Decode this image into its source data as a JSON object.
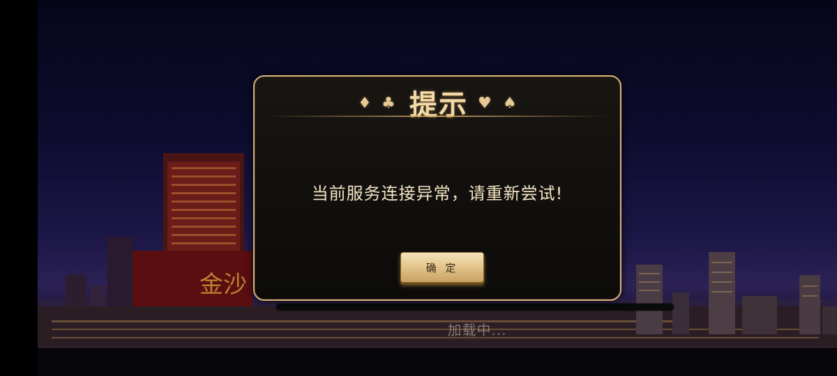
{
  "dialog": {
    "title": "提示",
    "message": "当前服务连接异常，请重新尝试!",
    "confirm_label": "确 定",
    "suits": {
      "diamond": "♦",
      "club": "♣",
      "heart": "♥",
      "spade": "♠"
    }
  },
  "loading": {
    "text": "加载中..."
  },
  "background": {
    "signage": "金沙"
  },
  "colors": {
    "gold_border": "#d8b27a",
    "title_gold": "#f1d9a8",
    "message": "#f3e4c2",
    "button_gold": "#e4c78e"
  }
}
